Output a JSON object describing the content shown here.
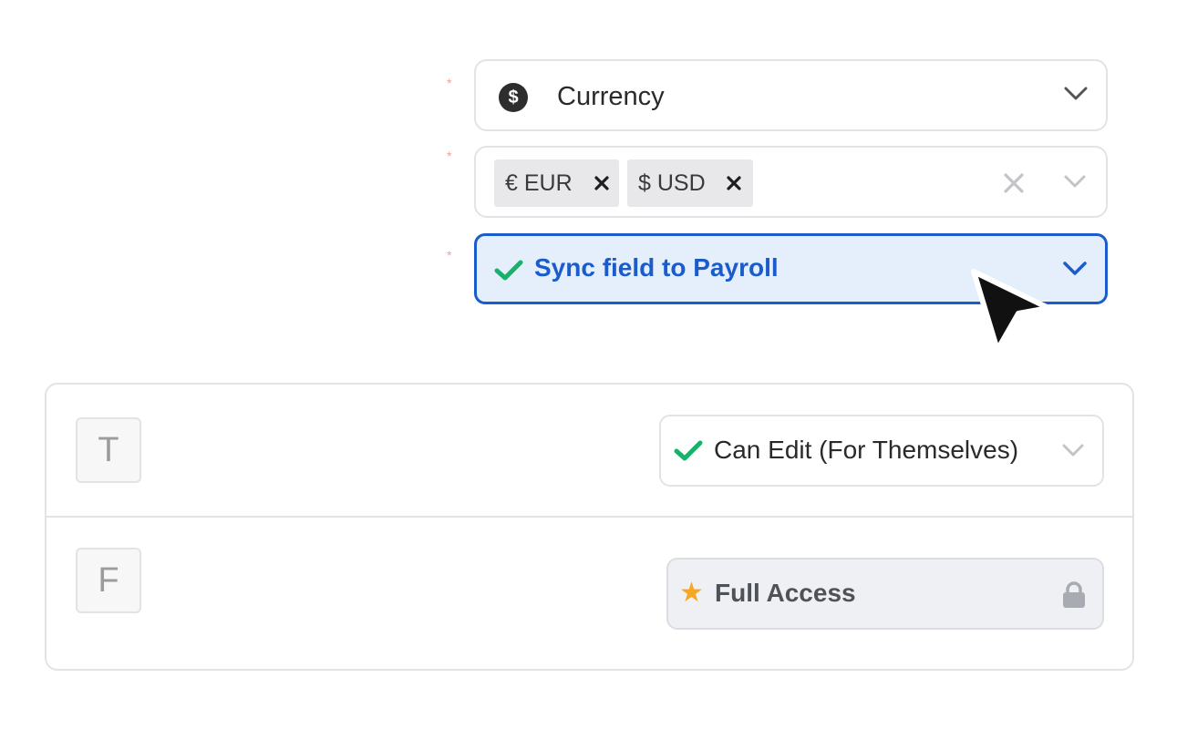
{
  "required_marker": "*",
  "currency_field": {
    "label": "Currency",
    "icon": "dollar-circle-icon",
    "icon_glyph": "$"
  },
  "currency_tags": {
    "tags": [
      {
        "label": "€ EUR",
        "remove": "×"
      },
      {
        "label": "$ USD",
        "remove": "×"
      }
    ]
  },
  "sync_field": {
    "label": "Sync field to Payroll",
    "icon": "check-icon",
    "accent": "#1a5ccc",
    "background": "#e5eefb"
  },
  "permissions": {
    "rows": [
      {
        "avatar": "T",
        "value": "Can Edit (For Themselves)",
        "icon": "check-icon"
      },
      {
        "avatar": "F",
        "value": "Full Access",
        "icon": "star-icon",
        "star": "★",
        "locked": true
      }
    ]
  },
  "colors": {
    "check": "#17b26a",
    "star": "#f6a623",
    "required": "#f0a3a3",
    "border": "#e2e3e6"
  }
}
